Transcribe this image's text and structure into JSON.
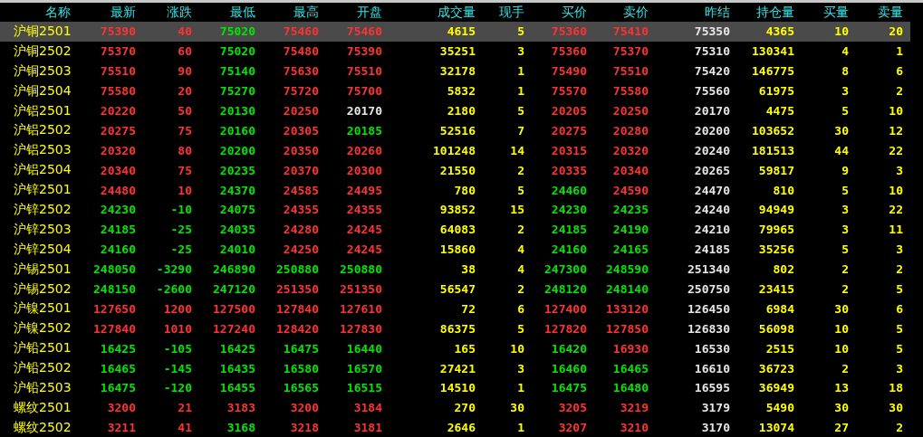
{
  "columns": [
    "名称",
    "最新",
    "涨跌",
    "最低",
    "最高",
    "开盘",
    "成交量",
    "现手",
    "买价",
    "卖价",
    "昨结",
    "持仓量",
    "买量",
    "卖量"
  ],
  "rows": [
    {
      "selected": true,
      "cells": [
        {
          "text": "沪铜2501",
          "color": "#ffff00"
        },
        {
          "text": "75390",
          "color": "#ff3232"
        },
        {
          "text": "40",
          "color": "#ff3232"
        },
        {
          "text": "75020",
          "color": "#00e600"
        },
        {
          "text": "75460",
          "color": "#ff3232"
        },
        {
          "text": "75460",
          "color": "#ff3232"
        },
        {
          "text": "4615",
          "color": "#ffff00"
        },
        {
          "text": "5",
          "color": "#ffff00"
        },
        {
          "text": "75360",
          "color": "#ff3232"
        },
        {
          "text": "75410",
          "color": "#ff3232"
        },
        {
          "text": "75350",
          "color": "#e6e6e6"
        },
        {
          "text": "4365",
          "color": "#ffff00"
        },
        {
          "text": "10",
          "color": "#ffff00"
        },
        {
          "text": "20",
          "color": "#ffff00"
        }
      ]
    },
    {
      "selected": false,
      "cells": [
        {
          "text": "沪铜2502",
          "color": "#ffff00"
        },
        {
          "text": "75370",
          "color": "#ff3232"
        },
        {
          "text": "60",
          "color": "#ff3232"
        },
        {
          "text": "75020",
          "color": "#00e600"
        },
        {
          "text": "75480",
          "color": "#ff3232"
        },
        {
          "text": "75390",
          "color": "#ff3232"
        },
        {
          "text": "35251",
          "color": "#ffff00"
        },
        {
          "text": "3",
          "color": "#ffff00"
        },
        {
          "text": "75360",
          "color": "#ff3232"
        },
        {
          "text": "75370",
          "color": "#ff3232"
        },
        {
          "text": "75310",
          "color": "#e6e6e6"
        },
        {
          "text": "130341",
          "color": "#ffff00"
        },
        {
          "text": "4",
          "color": "#ffff00"
        },
        {
          "text": "1",
          "color": "#ffff00"
        }
      ]
    },
    {
      "selected": false,
      "cells": [
        {
          "text": "沪铜2503",
          "color": "#ffff00"
        },
        {
          "text": "75510",
          "color": "#ff3232"
        },
        {
          "text": "90",
          "color": "#ff3232"
        },
        {
          "text": "75140",
          "color": "#00e600"
        },
        {
          "text": "75630",
          "color": "#ff3232"
        },
        {
          "text": "75510",
          "color": "#ff3232"
        },
        {
          "text": "32178",
          "color": "#ffff00"
        },
        {
          "text": "1",
          "color": "#ffff00"
        },
        {
          "text": "75490",
          "color": "#ff3232"
        },
        {
          "text": "75510",
          "color": "#ff3232"
        },
        {
          "text": "75420",
          "color": "#e6e6e6"
        },
        {
          "text": "146775",
          "color": "#ffff00"
        },
        {
          "text": "8",
          "color": "#ffff00"
        },
        {
          "text": "6",
          "color": "#ffff00"
        }
      ]
    },
    {
      "selected": false,
      "cells": [
        {
          "text": "沪铜2504",
          "color": "#ffff00"
        },
        {
          "text": "75580",
          "color": "#ff3232"
        },
        {
          "text": "20",
          "color": "#ff3232"
        },
        {
          "text": "75270",
          "color": "#00e600"
        },
        {
          "text": "75720",
          "color": "#ff3232"
        },
        {
          "text": "75700",
          "color": "#ff3232"
        },
        {
          "text": "5832",
          "color": "#ffff00"
        },
        {
          "text": "1",
          "color": "#ffff00"
        },
        {
          "text": "75570",
          "color": "#ff3232"
        },
        {
          "text": "75580",
          "color": "#ff3232"
        },
        {
          "text": "75560",
          "color": "#e6e6e6"
        },
        {
          "text": "61975",
          "color": "#ffff00"
        },
        {
          "text": "3",
          "color": "#ffff00"
        },
        {
          "text": "2",
          "color": "#ffff00"
        }
      ]
    },
    {
      "selected": false,
      "cells": [
        {
          "text": "沪铝2501",
          "color": "#ffff00"
        },
        {
          "text": "20220",
          "color": "#ff3232"
        },
        {
          "text": "50",
          "color": "#ff3232"
        },
        {
          "text": "20130",
          "color": "#00e600"
        },
        {
          "text": "20250",
          "color": "#ff3232"
        },
        {
          "text": "20170",
          "color": "#e6e6e6"
        },
        {
          "text": "2180",
          "color": "#ffff00"
        },
        {
          "text": "5",
          "color": "#ffff00"
        },
        {
          "text": "20205",
          "color": "#ff3232"
        },
        {
          "text": "20250",
          "color": "#ff3232"
        },
        {
          "text": "20170",
          "color": "#e6e6e6"
        },
        {
          "text": "4475",
          "color": "#ffff00"
        },
        {
          "text": "5",
          "color": "#ffff00"
        },
        {
          "text": "10",
          "color": "#ffff00"
        }
      ]
    },
    {
      "selected": false,
      "cells": [
        {
          "text": "沪铝2502",
          "color": "#ffff00"
        },
        {
          "text": "20275",
          "color": "#ff3232"
        },
        {
          "text": "75",
          "color": "#ff3232"
        },
        {
          "text": "20160",
          "color": "#00e600"
        },
        {
          "text": "20305",
          "color": "#ff3232"
        },
        {
          "text": "20185",
          "color": "#00e600"
        },
        {
          "text": "52516",
          "color": "#ffff00"
        },
        {
          "text": "7",
          "color": "#ffff00"
        },
        {
          "text": "20275",
          "color": "#ff3232"
        },
        {
          "text": "20280",
          "color": "#ff3232"
        },
        {
          "text": "20200",
          "color": "#e6e6e6"
        },
        {
          "text": "103652",
          "color": "#ffff00"
        },
        {
          "text": "30",
          "color": "#ffff00"
        },
        {
          "text": "12",
          "color": "#ffff00"
        }
      ]
    },
    {
      "selected": false,
      "cells": [
        {
          "text": "沪铝2503",
          "color": "#ffff00"
        },
        {
          "text": "20320",
          "color": "#ff3232"
        },
        {
          "text": "80",
          "color": "#ff3232"
        },
        {
          "text": "20200",
          "color": "#00e600"
        },
        {
          "text": "20350",
          "color": "#ff3232"
        },
        {
          "text": "20260",
          "color": "#ff3232"
        },
        {
          "text": "101248",
          "color": "#ffff00"
        },
        {
          "text": "14",
          "color": "#ffff00"
        },
        {
          "text": "20315",
          "color": "#ff3232"
        },
        {
          "text": "20320",
          "color": "#ff3232"
        },
        {
          "text": "20240",
          "color": "#e6e6e6"
        },
        {
          "text": "181513",
          "color": "#ffff00"
        },
        {
          "text": "44",
          "color": "#ffff00"
        },
        {
          "text": "22",
          "color": "#ffff00"
        }
      ]
    },
    {
      "selected": false,
      "cells": [
        {
          "text": "沪铝2504",
          "color": "#ffff00"
        },
        {
          "text": "20340",
          "color": "#ff3232"
        },
        {
          "text": "75",
          "color": "#ff3232"
        },
        {
          "text": "20235",
          "color": "#00e600"
        },
        {
          "text": "20370",
          "color": "#ff3232"
        },
        {
          "text": "20300",
          "color": "#ff3232"
        },
        {
          "text": "21550",
          "color": "#ffff00"
        },
        {
          "text": "2",
          "color": "#ffff00"
        },
        {
          "text": "20335",
          "color": "#ff3232"
        },
        {
          "text": "20340",
          "color": "#ff3232"
        },
        {
          "text": "20265",
          "color": "#e6e6e6"
        },
        {
          "text": "59817",
          "color": "#ffff00"
        },
        {
          "text": "9",
          "color": "#ffff00"
        },
        {
          "text": "3",
          "color": "#ffff00"
        }
      ]
    },
    {
      "selected": false,
      "cells": [
        {
          "text": "沪锌2501",
          "color": "#ffff00"
        },
        {
          "text": "24480",
          "color": "#ff3232"
        },
        {
          "text": "10",
          "color": "#ff3232"
        },
        {
          "text": "24370",
          "color": "#00e600"
        },
        {
          "text": "24585",
          "color": "#ff3232"
        },
        {
          "text": "24495",
          "color": "#ff3232"
        },
        {
          "text": "780",
          "color": "#ffff00"
        },
        {
          "text": "5",
          "color": "#ffff00"
        },
        {
          "text": "24460",
          "color": "#00e600"
        },
        {
          "text": "24590",
          "color": "#ff3232"
        },
        {
          "text": "24470",
          "color": "#e6e6e6"
        },
        {
          "text": "810",
          "color": "#ffff00"
        },
        {
          "text": "5",
          "color": "#ffff00"
        },
        {
          "text": "10",
          "color": "#ffff00"
        }
      ]
    },
    {
      "selected": false,
      "cells": [
        {
          "text": "沪锌2502",
          "color": "#ffff00"
        },
        {
          "text": "24230",
          "color": "#00e600"
        },
        {
          "text": "-10",
          "color": "#00e600"
        },
        {
          "text": "24075",
          "color": "#00e600"
        },
        {
          "text": "24355",
          "color": "#ff3232"
        },
        {
          "text": "24355",
          "color": "#ff3232"
        },
        {
          "text": "93852",
          "color": "#ffff00"
        },
        {
          "text": "15",
          "color": "#ffff00"
        },
        {
          "text": "24230",
          "color": "#00e600"
        },
        {
          "text": "24235",
          "color": "#00e600"
        },
        {
          "text": "24240",
          "color": "#e6e6e6"
        },
        {
          "text": "94949",
          "color": "#ffff00"
        },
        {
          "text": "3",
          "color": "#ffff00"
        },
        {
          "text": "22",
          "color": "#ffff00"
        }
      ]
    },
    {
      "selected": false,
      "cells": [
        {
          "text": "沪锌2503",
          "color": "#ffff00"
        },
        {
          "text": "24185",
          "color": "#00e600"
        },
        {
          "text": "-25",
          "color": "#00e600"
        },
        {
          "text": "24035",
          "color": "#00e600"
        },
        {
          "text": "24280",
          "color": "#ff3232"
        },
        {
          "text": "24245",
          "color": "#ff3232"
        },
        {
          "text": "64083",
          "color": "#ffff00"
        },
        {
          "text": "2",
          "color": "#ffff00"
        },
        {
          "text": "24185",
          "color": "#00e600"
        },
        {
          "text": "24190",
          "color": "#00e600"
        },
        {
          "text": "24210",
          "color": "#e6e6e6"
        },
        {
          "text": "79965",
          "color": "#ffff00"
        },
        {
          "text": "3",
          "color": "#ffff00"
        },
        {
          "text": "11",
          "color": "#ffff00"
        }
      ]
    },
    {
      "selected": false,
      "cells": [
        {
          "text": "沪锌2504",
          "color": "#ffff00"
        },
        {
          "text": "24160",
          "color": "#00e600"
        },
        {
          "text": "-25",
          "color": "#00e600"
        },
        {
          "text": "24010",
          "color": "#00e600"
        },
        {
          "text": "24250",
          "color": "#ff3232"
        },
        {
          "text": "24245",
          "color": "#ff3232"
        },
        {
          "text": "15860",
          "color": "#ffff00"
        },
        {
          "text": "4",
          "color": "#ffff00"
        },
        {
          "text": "24160",
          "color": "#00e600"
        },
        {
          "text": "24165",
          "color": "#00e600"
        },
        {
          "text": "24185",
          "color": "#e6e6e6"
        },
        {
          "text": "35256",
          "color": "#ffff00"
        },
        {
          "text": "5",
          "color": "#ffff00"
        },
        {
          "text": "3",
          "color": "#ffff00"
        }
      ]
    },
    {
      "selected": false,
      "cells": [
        {
          "text": "沪锡2501",
          "color": "#ffff00"
        },
        {
          "text": "248050",
          "color": "#00e600"
        },
        {
          "text": "-3290",
          "color": "#00e600"
        },
        {
          "text": "246890",
          "color": "#00e600"
        },
        {
          "text": "250880",
          "color": "#00e600"
        },
        {
          "text": "250880",
          "color": "#00e600"
        },
        {
          "text": "38",
          "color": "#ffff00"
        },
        {
          "text": "4",
          "color": "#ffff00"
        },
        {
          "text": "247300",
          "color": "#00e600"
        },
        {
          "text": "248590",
          "color": "#00e600"
        },
        {
          "text": "251340",
          "color": "#e6e6e6"
        },
        {
          "text": "802",
          "color": "#ffff00"
        },
        {
          "text": "2",
          "color": "#ffff00"
        },
        {
          "text": "2",
          "color": "#ffff00"
        }
      ]
    },
    {
      "selected": false,
      "cells": [
        {
          "text": "沪锡2502",
          "color": "#ffff00"
        },
        {
          "text": "248150",
          "color": "#00e600"
        },
        {
          "text": "-2600",
          "color": "#00e600"
        },
        {
          "text": "247120",
          "color": "#00e600"
        },
        {
          "text": "251350",
          "color": "#ff3232"
        },
        {
          "text": "251350",
          "color": "#ff3232"
        },
        {
          "text": "56547",
          "color": "#ffff00"
        },
        {
          "text": "2",
          "color": "#ffff00"
        },
        {
          "text": "248120",
          "color": "#00e600"
        },
        {
          "text": "248140",
          "color": "#00e600"
        },
        {
          "text": "250750",
          "color": "#e6e6e6"
        },
        {
          "text": "23415",
          "color": "#ffff00"
        },
        {
          "text": "2",
          "color": "#ffff00"
        },
        {
          "text": "5",
          "color": "#ffff00"
        }
      ]
    },
    {
      "selected": false,
      "cells": [
        {
          "text": "沪镍2501",
          "color": "#ffff00"
        },
        {
          "text": "127650",
          "color": "#ff3232"
        },
        {
          "text": "1200",
          "color": "#ff3232"
        },
        {
          "text": "127500",
          "color": "#ff3232"
        },
        {
          "text": "127840",
          "color": "#ff3232"
        },
        {
          "text": "127610",
          "color": "#ff3232"
        },
        {
          "text": "72",
          "color": "#ffff00"
        },
        {
          "text": "6",
          "color": "#ffff00"
        },
        {
          "text": "127400",
          "color": "#ff3232"
        },
        {
          "text": "133120",
          "color": "#ff3232"
        },
        {
          "text": "126450",
          "color": "#e6e6e6"
        },
        {
          "text": "6984",
          "color": "#ffff00"
        },
        {
          "text": "30",
          "color": "#ffff00"
        },
        {
          "text": "6",
          "color": "#ffff00"
        }
      ]
    },
    {
      "selected": false,
      "cells": [
        {
          "text": "沪镍2502",
          "color": "#ffff00"
        },
        {
          "text": "127840",
          "color": "#ff3232"
        },
        {
          "text": "1010",
          "color": "#ff3232"
        },
        {
          "text": "127240",
          "color": "#ff3232"
        },
        {
          "text": "128420",
          "color": "#ff3232"
        },
        {
          "text": "127830",
          "color": "#ff3232"
        },
        {
          "text": "86375",
          "color": "#ffff00"
        },
        {
          "text": "5",
          "color": "#ffff00"
        },
        {
          "text": "127820",
          "color": "#ff3232"
        },
        {
          "text": "127850",
          "color": "#ff3232"
        },
        {
          "text": "126830",
          "color": "#e6e6e6"
        },
        {
          "text": "56098",
          "color": "#ffff00"
        },
        {
          "text": "10",
          "color": "#ffff00"
        },
        {
          "text": "5",
          "color": "#ffff00"
        }
      ]
    },
    {
      "selected": false,
      "cells": [
        {
          "text": "沪铅2501",
          "color": "#ffff00"
        },
        {
          "text": "16425",
          "color": "#00e600"
        },
        {
          "text": "-105",
          "color": "#00e600"
        },
        {
          "text": "16425",
          "color": "#00e600"
        },
        {
          "text": "16475",
          "color": "#00e600"
        },
        {
          "text": "16440",
          "color": "#00e600"
        },
        {
          "text": "165",
          "color": "#ffff00"
        },
        {
          "text": "10",
          "color": "#ffff00"
        },
        {
          "text": "16420",
          "color": "#00e600"
        },
        {
          "text": "16930",
          "color": "#ff3232"
        },
        {
          "text": "16530",
          "color": "#e6e6e6"
        },
        {
          "text": "2515",
          "color": "#ffff00"
        },
        {
          "text": "10",
          "color": "#ffff00"
        },
        {
          "text": "5",
          "color": "#ffff00"
        }
      ]
    },
    {
      "selected": false,
      "cells": [
        {
          "text": "沪铅2502",
          "color": "#ffff00"
        },
        {
          "text": "16465",
          "color": "#00e600"
        },
        {
          "text": "-145",
          "color": "#00e600"
        },
        {
          "text": "16435",
          "color": "#00e600"
        },
        {
          "text": "16580",
          "color": "#00e600"
        },
        {
          "text": "16570",
          "color": "#00e600"
        },
        {
          "text": "27421",
          "color": "#ffff00"
        },
        {
          "text": "3",
          "color": "#ffff00"
        },
        {
          "text": "16460",
          "color": "#00e600"
        },
        {
          "text": "16465",
          "color": "#00e600"
        },
        {
          "text": "16610",
          "color": "#e6e6e6"
        },
        {
          "text": "36723",
          "color": "#ffff00"
        },
        {
          "text": "2",
          "color": "#ffff00"
        },
        {
          "text": "3",
          "color": "#ffff00"
        }
      ]
    },
    {
      "selected": false,
      "cells": [
        {
          "text": "沪铅2503",
          "color": "#ffff00"
        },
        {
          "text": "16475",
          "color": "#00e600"
        },
        {
          "text": "-120",
          "color": "#00e600"
        },
        {
          "text": "16455",
          "color": "#00e600"
        },
        {
          "text": "16565",
          "color": "#00e600"
        },
        {
          "text": "16515",
          "color": "#00e600"
        },
        {
          "text": "14510",
          "color": "#ffff00"
        },
        {
          "text": "1",
          "color": "#ffff00"
        },
        {
          "text": "16475",
          "color": "#00e600"
        },
        {
          "text": "16480",
          "color": "#00e600"
        },
        {
          "text": "16595",
          "color": "#e6e6e6"
        },
        {
          "text": "36949",
          "color": "#ffff00"
        },
        {
          "text": "13",
          "color": "#ffff00"
        },
        {
          "text": "18",
          "color": "#ffff00"
        }
      ]
    },
    {
      "selected": false,
      "cells": [
        {
          "text": "螺纹2501",
          "color": "#ffff00"
        },
        {
          "text": "3200",
          "color": "#ff3232"
        },
        {
          "text": "21",
          "color": "#ff3232"
        },
        {
          "text": "3183",
          "color": "#ff3232"
        },
        {
          "text": "3200",
          "color": "#ff3232"
        },
        {
          "text": "3184",
          "color": "#ff3232"
        },
        {
          "text": "270",
          "color": "#ffff00"
        },
        {
          "text": "30",
          "color": "#ffff00"
        },
        {
          "text": "3205",
          "color": "#ff3232"
        },
        {
          "text": "3219",
          "color": "#ff3232"
        },
        {
          "text": "3179",
          "color": "#e6e6e6"
        },
        {
          "text": "5490",
          "color": "#ffff00"
        },
        {
          "text": "30",
          "color": "#ffff00"
        },
        {
          "text": "30",
          "color": "#ffff00"
        }
      ]
    },
    {
      "selected": false,
      "cells": [
        {
          "text": "螺纹2502",
          "color": "#ffff00"
        },
        {
          "text": "3211",
          "color": "#ff3232"
        },
        {
          "text": "41",
          "color": "#ff3232"
        },
        {
          "text": "3168",
          "color": "#00e600"
        },
        {
          "text": "3218",
          "color": "#ff3232"
        },
        {
          "text": "3181",
          "color": "#ff3232"
        },
        {
          "text": "2646",
          "color": "#ffff00"
        },
        {
          "text": "1",
          "color": "#ffff00"
        },
        {
          "text": "3207",
          "color": "#ff3232"
        },
        {
          "text": "3210",
          "color": "#ff3232"
        },
        {
          "text": "3170",
          "color": "#e6e6e6"
        },
        {
          "text": "13074",
          "color": "#ffff00"
        },
        {
          "text": "27",
          "color": "#ffff00"
        },
        {
          "text": "2",
          "color": "#ffff00"
        }
      ]
    }
  ]
}
